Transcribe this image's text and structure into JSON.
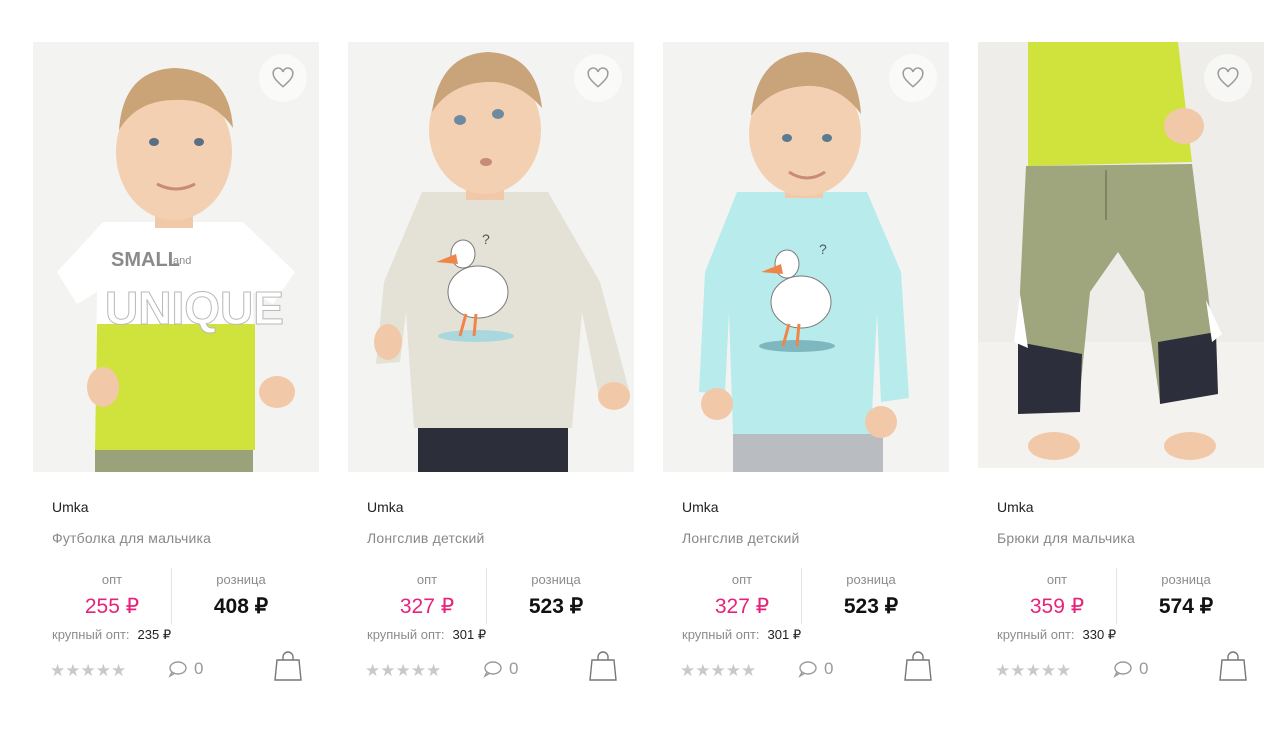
{
  "labels": {
    "opt": "опт",
    "retail": "розница",
    "bulk": "крупный опт:"
  },
  "colors": {
    "price_accent": "#e6237a"
  },
  "products": [
    {
      "brand": "Umka",
      "title": "Футболка для мальчика",
      "opt": "255 ₽",
      "retail": "408 ₽",
      "bulk": "235 ₽",
      "comments": "0",
      "stars": "★★★★★",
      "rating": 0
    },
    {
      "brand": "Umka",
      "title": "Лонгслив детский",
      "opt": "327 ₽",
      "retail": "523 ₽",
      "bulk": "301 ₽",
      "comments": "0",
      "stars": "★★★★★",
      "rating": 0
    },
    {
      "brand": "Umka",
      "title": "Лонгслив детский",
      "opt": "327 ₽",
      "retail": "523 ₽",
      "bulk": "301 ₽",
      "comments": "0",
      "stars": "★★★★★",
      "rating": 0
    },
    {
      "brand": "Umka",
      "title": "Брюки для мальчика",
      "opt": "359 ₽",
      "retail": "574 ₽",
      "bulk": "330 ₽",
      "comments": "0",
      "stars": "★★★★★",
      "rating": 0
    }
  ],
  "icons": {
    "favorite": "heart-icon",
    "comments": "speech-bubble-icon",
    "cart": "shopping-bag-icon"
  }
}
